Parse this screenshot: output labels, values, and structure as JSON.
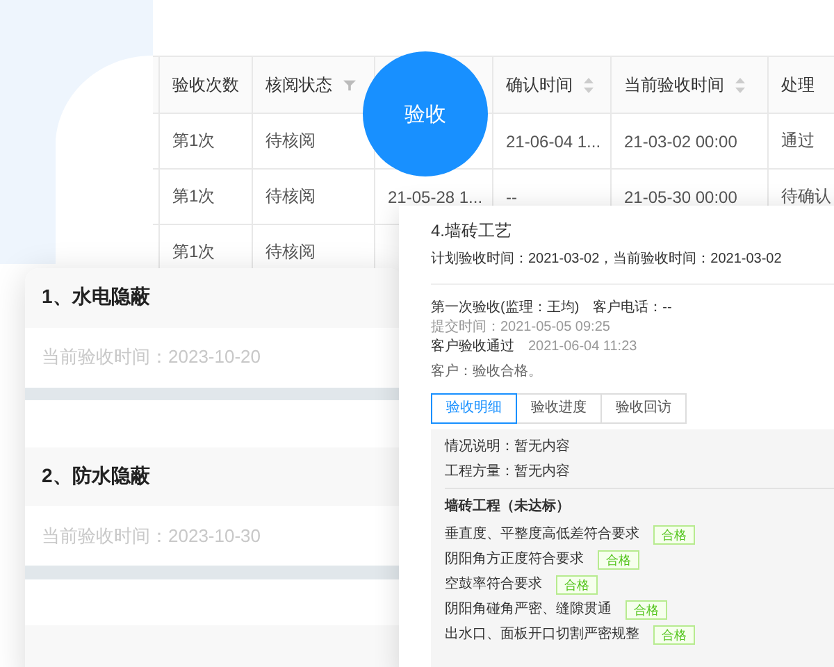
{
  "table": {
    "columns": [
      {
        "label": "验收次数",
        "kind": "plain"
      },
      {
        "label": "核阅状态",
        "kind": "filter"
      },
      {
        "kind": "plain"
      },
      {
        "label": "确认时间",
        "kind": "sort"
      },
      {
        "label": "当前验收时间",
        "kind": "sort"
      },
      {
        "label": "处理",
        "kind": "plain"
      }
    ],
    "rows": [
      [
        "第1次",
        "待核阅",
        null,
        "21-06-04 1...",
        "21-03-02 00:00",
        "通过"
      ],
      [
        "第1次",
        "待核阅",
        "21-05-28 1...",
        "--",
        "21-05-30 00:00",
        "待确认"
      ],
      [
        "第1次",
        "待核阅"
      ]
    ]
  },
  "accept_button": {
    "label": "验收"
  },
  "inspection_cards": [
    {
      "title": "1、水电隐蔽",
      "date": "当前验收时间：2023-10-20"
    },
    {
      "title": "2、防水隐蔽",
      "date": "当前验收时间：2023-10-30"
    }
  ],
  "detail": {
    "title": "4.墙砖工艺",
    "plan": "计划验收时间：2021-03-02，当前验收时间：2021-03-02",
    "record": {
      "inspector": "第一次验收(监理：王均)",
      "phone": "客户电话：--",
      "submitted": "提交时间：2021-05-05 09:25",
      "result": "客户验收通过",
      "result_time": "2021-06-04 11:23",
      "comment": "客户：验收合格。"
    },
    "tabs": [
      {
        "label": "验收明细",
        "selected": true
      },
      {
        "label": "验收进度",
        "selected": false
      },
      {
        "label": "验收回访",
        "selected": false
      }
    ],
    "info": [
      "情况说明：暂无内容",
      "工程方量：暂无内容"
    ],
    "section": "墙砖工程（未达标）",
    "items": [
      {
        "text": "垂直度、平整度高低差符合要求",
        "tag": "合格"
      },
      {
        "text": "阴阳角方正度符合要求",
        "tag": "合格"
      },
      {
        "text": "空鼓率符合要求",
        "tag": "合格"
      },
      {
        "text": "阴阳角碰角严密、缝隙贯通",
        "tag": "合格"
      },
      {
        "text": "出水口、面板开口切割严密规整",
        "tag": "合格"
      }
    ]
  }
}
